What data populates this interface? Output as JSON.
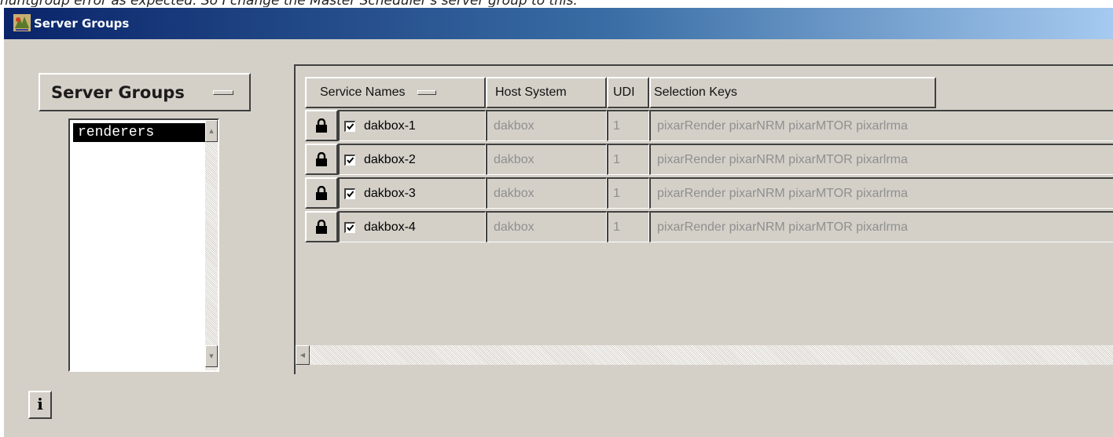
{
  "page_caption": "huntgroup error as expected. So I change the Master Scheduler's server group to this:",
  "window": {
    "title": "Server Groups"
  },
  "server_groups": {
    "menu_label": "Server Groups",
    "items": [
      "renderers"
    ],
    "selected": "renderers"
  },
  "table": {
    "headers": {
      "service_names": "Service Names",
      "host_system": "Host System",
      "udi": "UDI",
      "selection_keys": "Selection Keys"
    },
    "rows": [
      {
        "checked": true,
        "service_name": "dakbox-1",
        "host": "dakbox",
        "udi": "1",
        "keys": "pixarRender pixarNRM pixarMTOR pixarlrma"
      },
      {
        "checked": true,
        "service_name": "dakbox-2",
        "host": "dakbox",
        "udi": "1",
        "keys": "pixarRender pixarNRM pixarMTOR pixarlrma"
      },
      {
        "checked": true,
        "service_name": "dakbox-3",
        "host": "dakbox",
        "udi": "1",
        "keys": "pixarRender pixarNRM pixarMTOR pixarlrma"
      },
      {
        "checked": true,
        "service_name": "dakbox-4",
        "host": "dakbox",
        "udi": "1",
        "keys": "pixarRender pixarNRM pixarMTOR pixarlrma"
      }
    ]
  },
  "info_button": {
    "label": "i"
  },
  "icons": {
    "app": "app-icon",
    "lock": "lock-icon",
    "checkbox": "checkmark-icon",
    "scroll_up": "scroll-up-arrow-icon",
    "scroll_down": "scroll-down-arrow-icon",
    "scroll_left": "scroll-left-arrow-icon",
    "info": "info-icon"
  },
  "colors": {
    "titlebar_start": "#0a246a",
    "titlebar_end": "#a6caf0",
    "window_bg": "#d4d0c8",
    "disabled_text": "#8f8f8f",
    "selection_bg": "#000000"
  }
}
